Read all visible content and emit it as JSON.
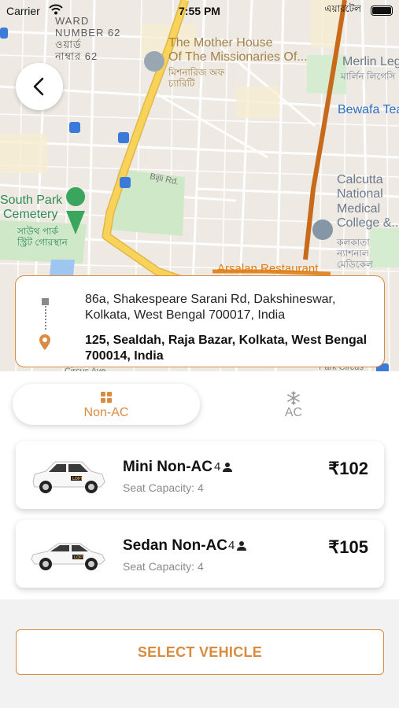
{
  "status_bar": {
    "carrier": "Carrier",
    "time": "7:55 PM",
    "network": "এয়ারটেল"
  },
  "map": {
    "labels": {
      "ward1": "WARD",
      "ward2": "NUMBER 62",
      "ward3": "ওয়ার্ড",
      "ward4": "নাম্বার 62",
      "mother_house1": "The Mother House",
      "mother_house2": "Of The Missionaries Of...",
      "mother_house_bn1": "মিশনারিজ অফ",
      "mother_house_bn2": "চ্যারিটি",
      "merlin": "Merlin Legacy",
      "merlin_bn": "মার্লিন লিগেসি",
      "bewafa": "Bewafa Tea",
      "bijli": "Bijli Rd.",
      "south_park1": "South Park",
      "south_park2": "Cemetery",
      "south_park_bn1": "সাউথ পার্ক",
      "south_park_bn2": "স্ট্রিট গোরস্থান",
      "calcutta1": "Calcutta",
      "calcutta2": "National",
      "calcutta3": "Medical",
      "calcutta4": "College &...",
      "calcutta_bn1": "কলকাতা",
      "calcutta_bn2": "ন্যাশনাল",
      "calcutta_bn3": "মেডিকেল",
      "arsalan": "Arsalan Restaurant",
      "circus": "Circus Ave",
      "park_circus": "Park Circus"
    }
  },
  "route": {
    "pickup": "86a, Shakespeare Sarani Rd, Dakshineswar, Kolkata, West Bengal 700017, India",
    "drop": "125, Sealdah, Raja Bazar, Kolkata, West Bengal 700014, India"
  },
  "tabs": [
    {
      "label": "Non-AC",
      "icon": "grid-icon",
      "selected": true
    },
    {
      "label": "AC",
      "icon": "snowflake-icon",
      "selected": false
    }
  ],
  "vehicles": [
    {
      "name": "Mini Non-AC",
      "seats": "4",
      "capacity": "Seat Capacity: 4",
      "price": "₹102",
      "icon": "hatchback-car-icon"
    },
    {
      "name": "Sedan Non-AC",
      "seats": "4",
      "capacity": "Seat Capacity: 4",
      "price": "₹105",
      "icon": "sedan-car-icon"
    }
  ],
  "actions": {
    "select_vehicle": "SELECT VEHICLE"
  },
  "colors": {
    "accent": "#D98B3F",
    "map_road_major": "#F5C13A",
    "map_route": "#D2691E",
    "map_green": "#CFE8C8"
  }
}
